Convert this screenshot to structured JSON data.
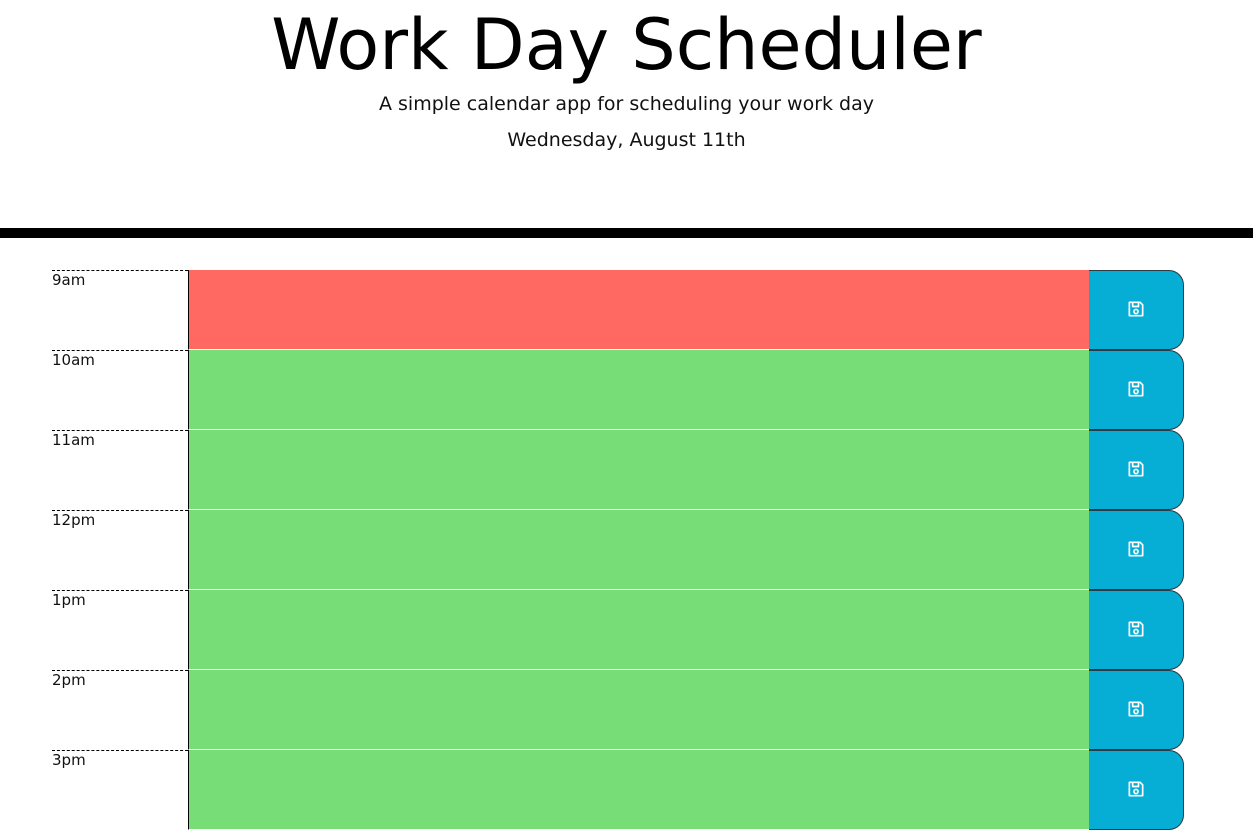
{
  "header": {
    "title": "Work Day Scheduler",
    "subtitle": "A simple calendar app for scheduling your work day",
    "current_day": "Wednesday, August 11th"
  },
  "colors": {
    "present": "#ff6961",
    "future": "#77dd77",
    "save_button": "#06aed5",
    "divider": "#000000"
  },
  "time_blocks": [
    {
      "hour": "9am",
      "status": "present",
      "text": ""
    },
    {
      "hour": "10am",
      "status": "future",
      "text": ""
    },
    {
      "hour": "11am",
      "status": "future",
      "text": ""
    },
    {
      "hour": "12pm",
      "status": "future",
      "text": ""
    },
    {
      "hour": "1pm",
      "status": "future",
      "text": ""
    },
    {
      "hour": "2pm",
      "status": "future",
      "text": ""
    },
    {
      "hour": "3pm",
      "status": "future",
      "text": ""
    }
  ],
  "save_icon": "floppy-disk-icon"
}
